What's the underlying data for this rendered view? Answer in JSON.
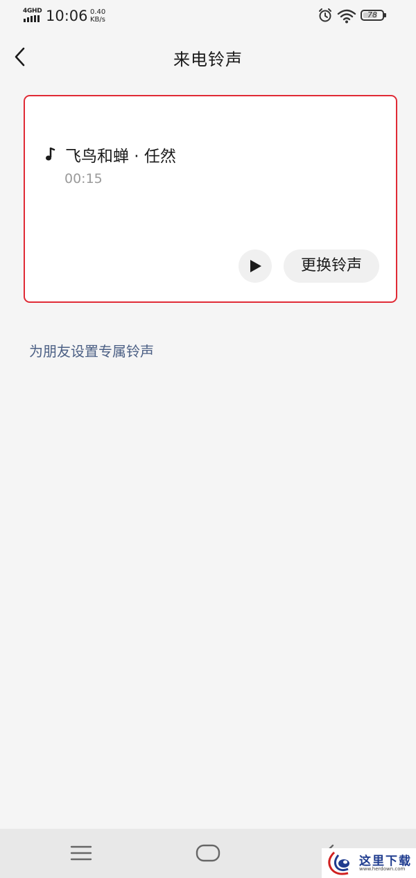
{
  "status_bar": {
    "network_type": "4GHD",
    "time": "10:06",
    "speed_value": "0.40",
    "speed_unit": "KB/s",
    "battery_level": "78",
    "battery_fraction": 0.78
  },
  "header": {
    "title": "来电铃声"
  },
  "ringtone_card": {
    "song_title": "飞鸟和蝉 · 任然",
    "duration": "00:15",
    "change_button_label": "更换铃声",
    "border_color": "#e02a35"
  },
  "friend_ringtone_link": "为朋友设置专属铃声",
  "watermark": {
    "text": "这里下载",
    "url": "www.herdown.com"
  },
  "colors": {
    "background": "#f5f5f5",
    "link": "#4b5f84",
    "card_highlight": "#e02a35"
  },
  "icons": [
    "alarm-icon",
    "wifi-icon",
    "battery-icon",
    "back-icon",
    "music-note-icon",
    "play-icon",
    "menu-icon",
    "home-icon",
    "back-nav-icon"
  ]
}
